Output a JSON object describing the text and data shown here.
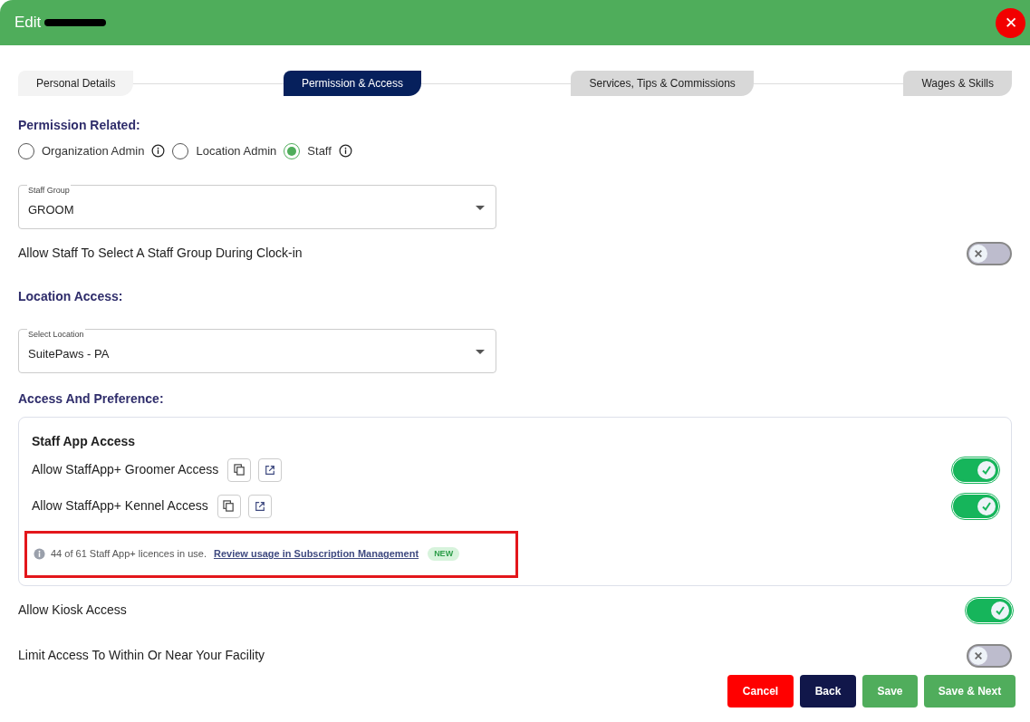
{
  "window": {
    "title": "Edit",
    "title_redacted": true,
    "close": "✕"
  },
  "tabs": [
    {
      "label": "Personal Details",
      "selected": false
    },
    {
      "label": "Permission & Access",
      "selected": true
    },
    {
      "label": "Services, Tips & Commissions",
      "selected": false
    },
    {
      "label": "Wages & Skills",
      "selected": false
    }
  ],
  "permission": {
    "heading": "Permission Related:",
    "options": [
      {
        "label": "Organization Admin",
        "selected": false,
        "info": true
      },
      {
        "label": "Location Admin",
        "selected": false,
        "info": false
      },
      {
        "label": "Staff",
        "selected": true,
        "info": true
      }
    ]
  },
  "staff_group": {
    "label": "Staff Group",
    "value": "GROOM"
  },
  "clock_in_toggle": {
    "label": "Allow Staff To Select A Staff Group During Clock-in",
    "on": false
  },
  "location": {
    "heading": "Location Access:",
    "label": "Select Location",
    "value": "SuitePaws - PA"
  },
  "access": {
    "heading": "Access And Preference:",
    "card_title": "Staff App Access",
    "items": [
      {
        "label": "Allow StaffApp+ Groomer Access",
        "on": true
      },
      {
        "label": "Allow StaffApp+ Kennel Access",
        "on": true
      }
    ],
    "notice": {
      "text": "44 of 61 Staff App+ licences in use.",
      "link": "Review usage in Subscription Management",
      "badge": "NEW",
      "highlighted": true
    }
  },
  "settings": [
    {
      "label": "Allow Kiosk Access",
      "on": true
    },
    {
      "label": "Limit Access To Within Or Near Your Facility",
      "on": false
    }
  ],
  "buttons": [
    {
      "label": "Cancel",
      "kind": "danger"
    },
    {
      "label": "Back",
      "kind": "dark"
    },
    {
      "label": "Save",
      "kind": "primary"
    },
    {
      "label": "Save & Next",
      "kind": "primary"
    }
  ]
}
